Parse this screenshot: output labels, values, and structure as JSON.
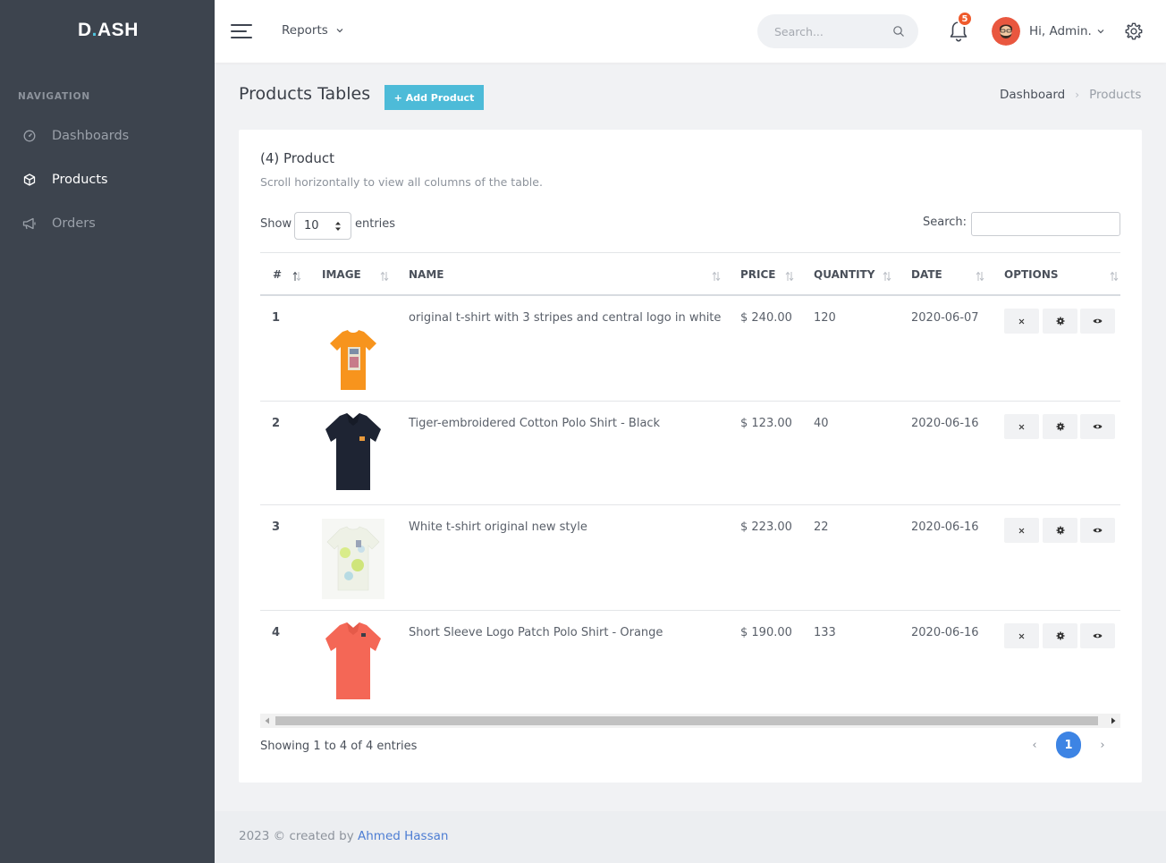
{
  "brand": {
    "logo_left": "D",
    "logo_dot": ".",
    "logo_right": "ASH"
  },
  "sidebar": {
    "heading": "NAVIGATION",
    "items": [
      {
        "label": "Dashboards",
        "icon": "dashboard-gauge-icon",
        "active": false
      },
      {
        "label": "Products",
        "icon": "box-icon",
        "active": true
      },
      {
        "label": "Orders",
        "icon": "megaphone-icon",
        "active": false
      }
    ]
  },
  "topbar": {
    "menu_label": "Reports",
    "search_placeholder": "Search...",
    "notification_count": "5",
    "greeting": "Hi, Admin."
  },
  "page": {
    "title": "Products Tables",
    "add_button": "+ Add Product",
    "breadcrumb": [
      "Dashboard",
      "Products"
    ]
  },
  "card": {
    "title": "(4) Product",
    "subtitle": "Scroll horizontally to view all columns of the table.",
    "show_label": "Show",
    "entries_value": "10",
    "entries_label": "entries",
    "search_label": "Search:"
  },
  "table": {
    "columns": [
      "#",
      "IMAGE",
      "NAME",
      "PRICE",
      "QUANTITY",
      "DATE",
      "OPTIONS"
    ],
    "rows": [
      {
        "num": "1",
        "name": "original t-shirt with 3 stripes and central logo in white",
        "price": "$ 240.00",
        "quantity": "120",
        "date": "2020-06-07",
        "image_color": "#f7941d",
        "image_type": "tshirt"
      },
      {
        "num": "2",
        "name": "Tiger-embroidered Cotton Polo Shirt - Black",
        "price": "$ 123.00",
        "quantity": "40",
        "date": "2020-06-16",
        "image_color": "#1e2433",
        "image_type": "polo"
      },
      {
        "num": "3",
        "name": "White t-shirt original new style",
        "price": "$ 223.00",
        "quantity": "22",
        "date": "2020-06-16",
        "image_color": "#eef1e6",
        "image_type": "tshirt"
      },
      {
        "num": "4",
        "name": "Short Sleeve Logo Patch Polo Shirt - Orange",
        "price": "$ 190.00",
        "quantity": "133",
        "date": "2020-06-16",
        "image_color": "#f46756",
        "image_type": "polo"
      }
    ]
  },
  "pagination": {
    "info": "Showing 1 to 4 of 4 entries",
    "prev": "‹",
    "current": "1",
    "next": "›"
  },
  "footer": {
    "text": "2023 © created by ",
    "author": "Ahmed Hassan"
  },
  "colors": {
    "sidebar_bg": "#3d444e",
    "accent": "#4dbbd8",
    "page_active": "#3d84e4",
    "badge": "#ef5a2c",
    "link": "#4d7dd3"
  }
}
